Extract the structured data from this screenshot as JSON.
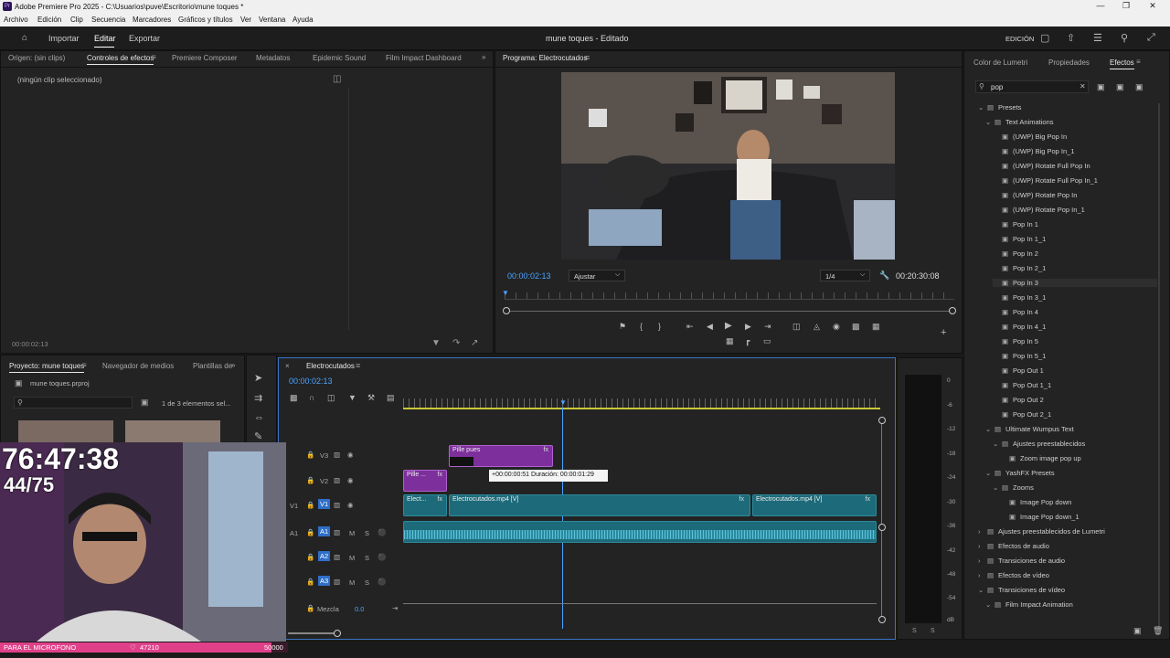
{
  "window": {
    "title": "Adobe Premiere Pro 2025 - C:\\Usuarios\\puve\\Escritorio\\mune toques *",
    "app_icon": "Pr"
  },
  "menu": [
    "Archivo",
    "Edición",
    "Clip",
    "Secuencia",
    "Marcadores",
    "Gráficos y títulos",
    "Ver",
    "Ventana",
    "Ayuda"
  ],
  "toolbar": {
    "import": "Importar",
    "edit": "Editar",
    "export": "Exportar",
    "project_title": "mune toques - Editado",
    "workspace": "EDICIÓN"
  },
  "source_panel": {
    "tabs": [
      "Origen: (sin clips)",
      "Controles de efectos",
      "Premiere Composer",
      "Metadatos",
      "Epidemic Sound",
      "Film Impact Dashboard"
    ],
    "active_tab": "Controles de efectos",
    "empty_msg": "(ningún clip seleccionado)",
    "timecode": "00:00:02:13"
  },
  "program_panel": {
    "title": "Programa: Electrocutados",
    "timecode": "00:00:02:13",
    "fit": "Ajustar",
    "resolution": "1/4",
    "duration": "00:20:30:08"
  },
  "project_panel": {
    "tabs": [
      "Proyecto: mune toques",
      "Navegador de medios",
      "Plantillas de"
    ],
    "file": "mune toques.prproj",
    "count": "1 de 3 elementos sel..."
  },
  "timeline": {
    "sequence": "Electrocutados",
    "timecode": "00:00:02:13",
    "tracks": {
      "v3": "V3",
      "v2": "V2",
      "v1": "V1",
      "a1": "A1",
      "a2": "A2",
      "a3": "A3"
    },
    "mix_label": "Mezcla",
    "mix_value": "0.0",
    "clips": {
      "v3_clip": "Pille pues",
      "v2_clip": "Pille ...",
      "v1_a": "Elect...",
      "v1_b": "Electrocutados.mp4 [V]",
      "v1_c": "Electrocutados.mp4 [V]",
      "fx": "fx"
    },
    "tooltip": "+00:00:00:51 Duración: 00:00:01:29"
  },
  "meter": {
    "scale": [
      "0",
      "-6",
      "-12",
      "-18",
      "-24",
      "-30",
      "-36",
      "-42",
      "-48",
      "-54",
      "dB"
    ],
    "solo": "S"
  },
  "effects_panel": {
    "tabs": [
      "Color de Lumetri",
      "Propiedades",
      "Efectos"
    ],
    "active_tab": "Efectos",
    "search": "pop",
    "tree": [
      {
        "label": "Presets",
        "level": 0,
        "type": "folder",
        "open": true
      },
      {
        "label": "Text Animations",
        "level": 1,
        "type": "folder",
        "open": true
      },
      {
        "label": "(UWP) Big Pop In",
        "level": 2,
        "type": "preset"
      },
      {
        "label": "(UWP) Big Pop In_1",
        "level": 2,
        "type": "preset"
      },
      {
        "label": "(UWP) Rotate Full Pop In",
        "level": 2,
        "type": "preset"
      },
      {
        "label": "(UWP) Rotate Full Pop In_1",
        "level": 2,
        "type": "preset"
      },
      {
        "label": "(UWP) Rotate Pop In",
        "level": 2,
        "type": "preset"
      },
      {
        "label": "(UWP) Rotate Pop In_1",
        "level": 2,
        "type": "preset"
      },
      {
        "label": "Pop In 1",
        "level": 2,
        "type": "preset"
      },
      {
        "label": "Pop In 1_1",
        "level": 2,
        "type": "preset"
      },
      {
        "label": "Pop In 2",
        "level": 2,
        "type": "preset"
      },
      {
        "label": "Pop In 2_1",
        "level": 2,
        "type": "preset"
      },
      {
        "label": "Pop In 3",
        "level": 2,
        "type": "preset",
        "selected": true
      },
      {
        "label": "Pop In 3_1",
        "level": 2,
        "type": "preset"
      },
      {
        "label": "Pop In 4",
        "level": 2,
        "type": "preset"
      },
      {
        "label": "Pop In 4_1",
        "level": 2,
        "type": "preset"
      },
      {
        "label": "Pop In 5",
        "level": 2,
        "type": "preset"
      },
      {
        "label": "Pop In 5_1",
        "level": 2,
        "type": "preset"
      },
      {
        "label": "Pop Out 1",
        "level": 2,
        "type": "preset"
      },
      {
        "label": "Pop Out 1_1",
        "level": 2,
        "type": "preset"
      },
      {
        "label": "Pop Out 2",
        "level": 2,
        "type": "preset"
      },
      {
        "label": "Pop Out 2_1",
        "level": 2,
        "type": "preset"
      },
      {
        "label": "Ultimate Wumpus Text",
        "level": 1,
        "type": "folder",
        "open": true
      },
      {
        "label": "Ajustes preestablecidos",
        "level": 2,
        "type": "folder",
        "open": true
      },
      {
        "label": "Zoom image pop up",
        "level": 3,
        "type": "preset"
      },
      {
        "label": "YashFX Presets",
        "level": 1,
        "type": "folder",
        "open": true
      },
      {
        "label": "Zooms",
        "level": 2,
        "type": "folder",
        "open": true
      },
      {
        "label": "Image Pop down",
        "level": 3,
        "type": "preset"
      },
      {
        "label": "Image Pop down_1",
        "level": 3,
        "type": "preset"
      },
      {
        "label": "Ajustes preestablecidos de Lumetri",
        "level": 0,
        "type": "folder",
        "open": false
      },
      {
        "label": "Efectos de audio",
        "level": 0,
        "type": "folder",
        "open": false
      },
      {
        "label": "Transiciones de audio",
        "level": 0,
        "type": "folder",
        "open": false
      },
      {
        "label": "Efectos de vídeo",
        "level": 0,
        "type": "folder",
        "open": false
      },
      {
        "label": "Transiciones de vídeo",
        "level": 0,
        "type": "folder",
        "open": true
      },
      {
        "label": "Film Impact Animation",
        "level": 1,
        "type": "folder",
        "open": true
      }
    ]
  },
  "stream_overlay": {
    "timer": "76:47:38",
    "count": "44/75",
    "bar_label": "PARA EL MICROFONO",
    "bar_current": "47210",
    "bar_goal": "50000",
    "progress": 0.944
  }
}
